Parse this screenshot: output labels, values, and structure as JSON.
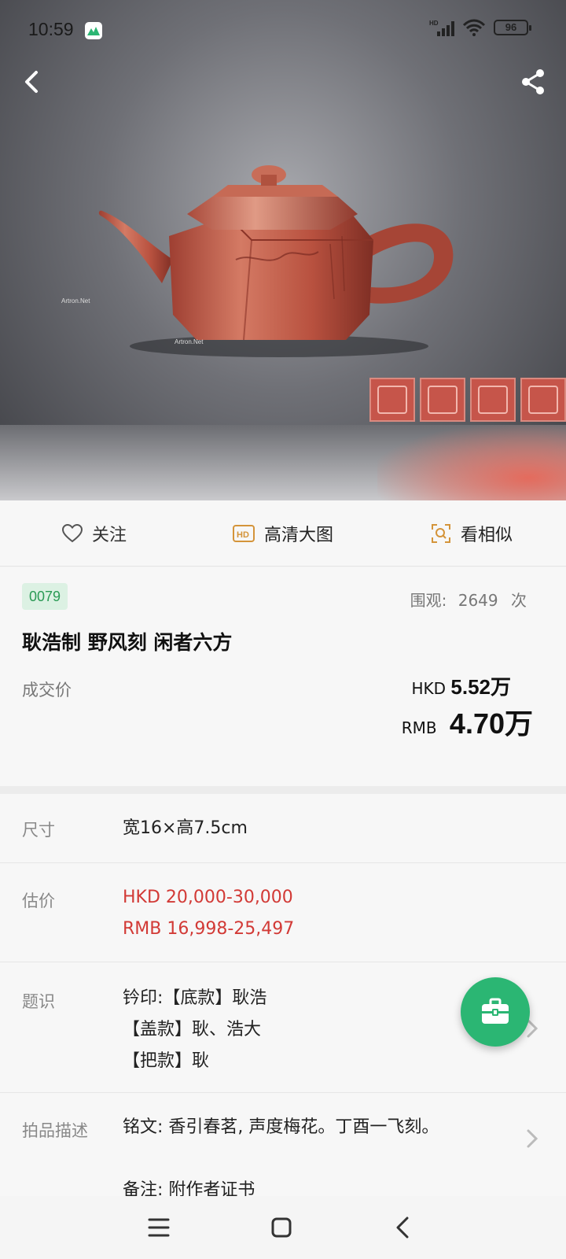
{
  "status_bar": {
    "time": "10:59",
    "battery": "96"
  },
  "hero": {
    "watermark": "Artron.Net"
  },
  "actions": [
    {
      "label": "关注",
      "icon": "heart-outline-icon"
    },
    {
      "label": "高清大图",
      "icon": "hd-icon"
    },
    {
      "label": "看相似",
      "icon": "search-similar-icon"
    }
  ],
  "lot": {
    "number": "0079",
    "views_label": "围观:",
    "views_count": "2649",
    "views_unit": "次",
    "title": "耿浩制 野风刻 闲者六方",
    "deal_label": "成交价",
    "hkd_currency": "HKD",
    "hkd_price": "5.52万",
    "rmb_currency": "RMB",
    "rmb_price": "4.70万"
  },
  "details": {
    "size_label": "尺寸",
    "size_value": "宽16×高7.5cm",
    "estimate_label": "估价",
    "estimate_hkd": "HKD  20,000-30,000",
    "estimate_rmb": "RMB 16,998-25,497",
    "inscription_label": "题识",
    "inscription_lines": [
      "钤印:【底款】耿浩",
      "【盖款】耿、浩大",
      "【把款】耿"
    ],
    "description_label": "拍品描述",
    "description_line1": "铭文: 香引春茗, 声度梅花。丁酉一飞刻。",
    "description_line2": "备注: 附作者证书"
  },
  "colors": {
    "accent_green": "#2bb673",
    "estimate_red": "#d23a36",
    "lot_badge_bg": "#dcf1e3"
  }
}
